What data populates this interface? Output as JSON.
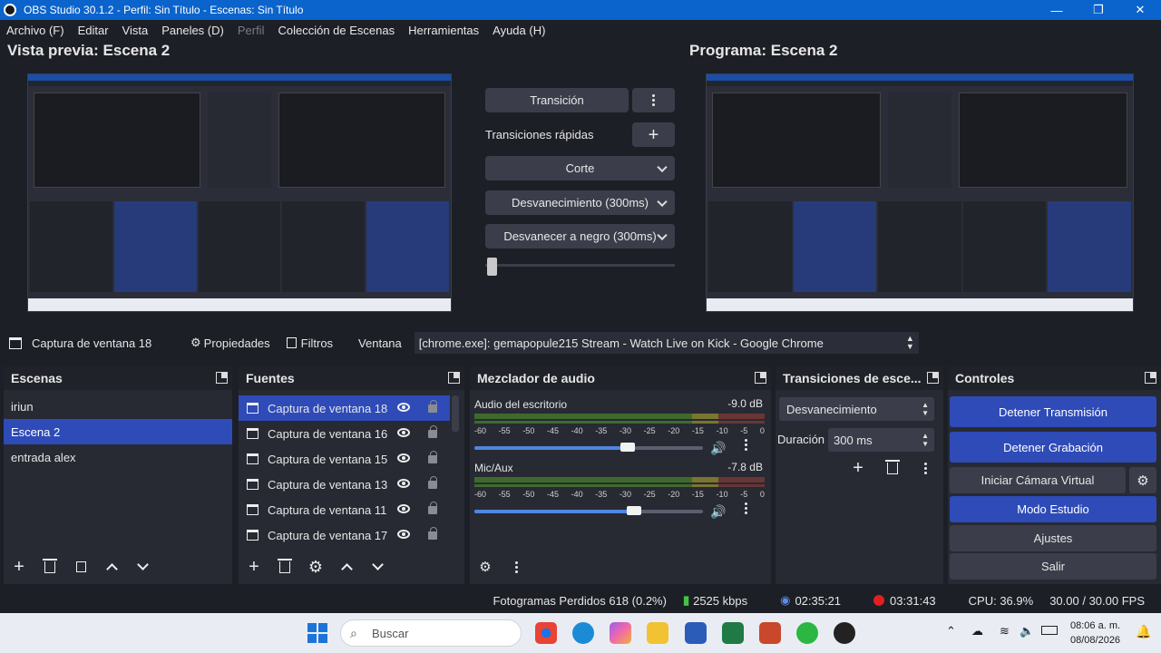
{
  "window": {
    "title": "OBS Studio 30.1.2 - Perfil: Sin Título - Escenas: Sin Título"
  },
  "menu": [
    "Archivo (F)",
    "Editar",
    "Vista",
    "Paneles (D)",
    "Perfil",
    "Colección de Escenas",
    "Herramientas",
    "Ayuda (H)"
  ],
  "preview": {
    "left_title": "Vista previa: Escena 2",
    "right_title": "Programa: Escena 2"
  },
  "transitions_panel": {
    "transition_label": "Transición",
    "quick_label": "Transiciones rápidas",
    "options": [
      "Corte",
      "Desvanecimiento (300ms)",
      "Desvanecer a negro (300ms)"
    ]
  },
  "source_bar": {
    "selected_source": "Captura de ventana 18",
    "properties": "Propiedades",
    "filters": "Filtros",
    "window_label": "Ventana",
    "window_value": "[chrome.exe]: gemapopule215 Stream - Watch Live on Kick - Google Chrome"
  },
  "scenes": {
    "title": "Escenas",
    "items": [
      "iriun",
      "Escena 2",
      "entrada alex"
    ],
    "selected": "Escena 2"
  },
  "sources": {
    "title": "Fuentes",
    "items": [
      "Captura de ventana 18",
      "Captura de ventana 16",
      "Captura de ventana 15",
      "Captura de ventana 13",
      "Captura de ventana 11",
      "Captura de ventana 17"
    ]
  },
  "mixer": {
    "title": "Mezclador de audio",
    "ticks": [
      "-60",
      "-55",
      "-50",
      "-45",
      "-40",
      "-35",
      "-30",
      "-25",
      "-20",
      "-15",
      "-10",
      "-5",
      "0"
    ],
    "channels": [
      {
        "name": "Audio del escritorio",
        "db": "-9.0 dB",
        "volume_fraction": 0.67
      },
      {
        "name": "Mic/Aux",
        "db": "-7.8 dB",
        "volume_fraction": 0.7
      }
    ]
  },
  "scene_transitions": {
    "title": "Transiciones de esce...",
    "type": "Desvanecimiento",
    "duration_label": "Duración",
    "duration_value": "300 ms"
  },
  "controls": {
    "title": "Controles",
    "stop_stream": "Detener Transmisión",
    "stop_record": "Detener Grabación",
    "virtual_cam": "Iniciar Cámara Virtual",
    "studio_mode": "Modo Estudio",
    "settings": "Ajustes",
    "exit": "Salir"
  },
  "status": {
    "dropped": "Fotogramas Perdidos 618 (0.2%)",
    "bitrate": "2525 kbps",
    "stream_time": "02:35:21",
    "rec_time": "03:31:43",
    "cpu": "CPU: 36.9%",
    "fps": "30.00 / 30.00 FPS"
  },
  "taskbar": {
    "search_placeholder": "Buscar",
    "time": "08:06 a. m.",
    "date": "08/08/2026"
  },
  "colors": {
    "accent": "#2e4bb8",
    "titlebar": "#0b63cc",
    "rec": "#e02020",
    "bitrate": "#43c443"
  }
}
